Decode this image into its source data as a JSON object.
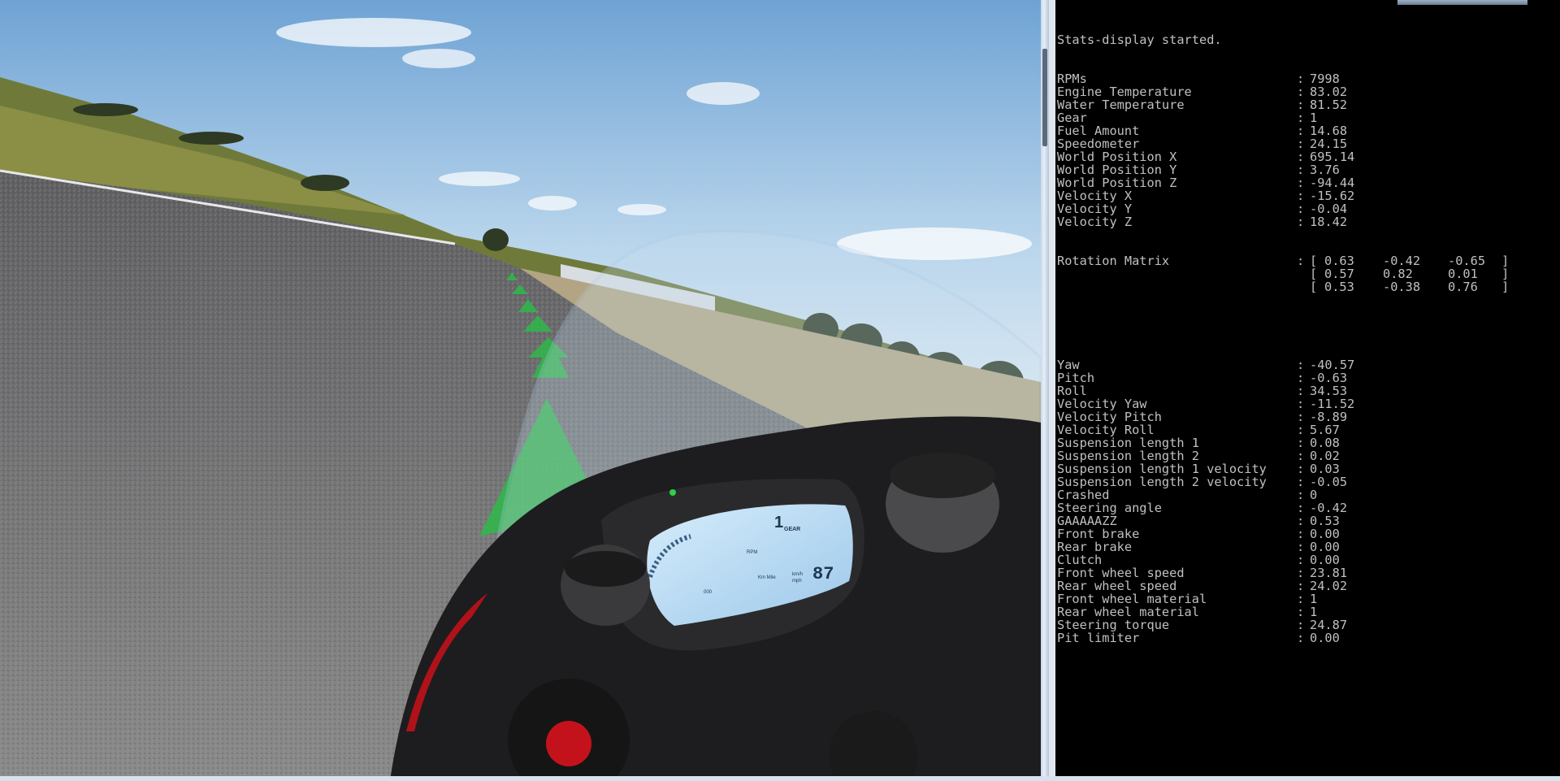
{
  "console": {
    "header": "Stats-display started.",
    "separator": ":",
    "stats_before_matrix": [
      {
        "label": "RPMs",
        "value": "7998"
      },
      {
        "label": "Engine Temperature",
        "value": "83.02"
      },
      {
        "label": "Water Temperature",
        "value": "81.52"
      },
      {
        "label": "Gear",
        "value": "1"
      },
      {
        "label": "Fuel Amount",
        "value": "14.68"
      },
      {
        "label": "Speedometer",
        "value": "24.15"
      },
      {
        "label": "World Position X",
        "value": "695.14"
      },
      {
        "label": "World Position Y",
        "value": "3.76"
      },
      {
        "label": "World Position Z",
        "value": "-94.44"
      },
      {
        "label": "Velocity X",
        "value": "-15.62"
      },
      {
        "label": "Velocity Y",
        "value": "-0.04"
      },
      {
        "label": "Velocity Z",
        "value": "18.42"
      }
    ],
    "rotation_matrix": {
      "label": "Rotation Matrix",
      "open": "[",
      "close": "]",
      "rows": [
        [
          "0.63",
          "-0.42",
          "-0.65"
        ],
        [
          "0.57",
          "0.82",
          "0.01"
        ],
        [
          "0.53",
          "-0.38",
          "0.76"
        ]
      ]
    },
    "stats_after_matrix": [
      {
        "label": "Yaw",
        "value": "-40.57"
      },
      {
        "label": "Pitch",
        "value": "-0.63"
      },
      {
        "label": "Roll",
        "value": "34.53"
      },
      {
        "label": "Velocity Yaw",
        "value": "-11.52"
      },
      {
        "label": "Velocity Pitch",
        "value": "-8.89"
      },
      {
        "label": "Velocity Roll",
        "value": "5.67"
      },
      {
        "label": "Suspension length 1",
        "value": "0.08"
      },
      {
        "label": "Suspension length 2",
        "value": "0.02"
      },
      {
        "label": "Suspension length 1 velocity",
        "value": "0.03"
      },
      {
        "label": "Suspension length 2 velocity",
        "value": "-0.05"
      },
      {
        "label": "Crashed",
        "value": "0"
      },
      {
        "label": "Steering angle",
        "value": "-0.42"
      },
      {
        "label": "GAAAAAZZ",
        "value": "0.53"
      },
      {
        "label": "Front brake",
        "value": "0.00"
      },
      {
        "label": "Rear brake",
        "value": "0.00"
      },
      {
        "label": "Clutch",
        "value": "0.00"
      },
      {
        "label": "Front wheel speed",
        "value": "23.81"
      },
      {
        "label": "Rear wheel speed",
        "value": "24.02"
      },
      {
        "label": "Front wheel material",
        "value": "1"
      },
      {
        "label": "Rear wheel material",
        "value": "1"
      },
      {
        "label": "Steering torque",
        "value": "24.87"
      },
      {
        "label": "Pit limiter",
        "value": "0.00"
      }
    ]
  },
  "dashboard": {
    "gear_label": "GEAR",
    "gear_value": "1",
    "speed_value": "87",
    "speed_unit_1": "km/h",
    "speed_unit_2": "mph",
    "rpm_label": "RPM",
    "odo_label": "Km Mile",
    "left_readout": "000"
  },
  "colors": {
    "sky": "#8fbde3",
    "asphalt": "#6e6e6e",
    "guide_arrow": "#2fb84a",
    "dash_lcd": "#bcdcf3",
    "console_text": "#c0c0c0",
    "console_bg": "#000000"
  }
}
